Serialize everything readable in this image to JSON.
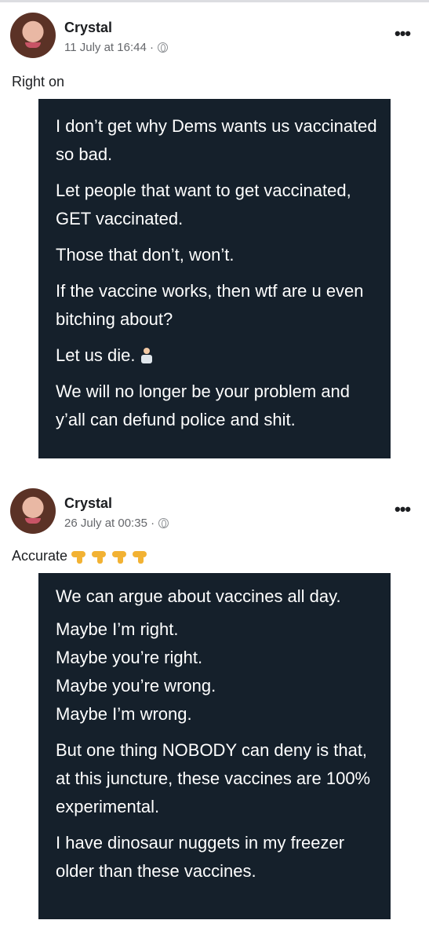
{
  "posts": [
    {
      "author": "Crystal",
      "meta": "11 July at 16:44 ·",
      "caption": "Right on",
      "tweet": [
        "I don’t get why Dems wants us vaccinated so bad.",
        "Let people that want to get vaccinated, GET vaccinated.",
        "Those that don’t, won’t.",
        "If the vaccine works, then wtf are u even bitching about?",
        "Let us die.",
        "We will no longer be your problem and y’all can defund police and shit."
      ],
      "icons": [
        "avatar-photo",
        "globe-icon",
        "more-options-icon",
        "person-shrugging-emoji"
      ]
    },
    {
      "author": "Crystal",
      "meta": "26 July at 00:35 ·",
      "caption": "Accurate",
      "tweet_lines": [
        "We can argue about vaccines all day.",
        "Maybe I’m right.",
        "Maybe you’re right.",
        "Maybe you’re wrong.",
        "Maybe I’m wrong."
      ],
      "tweet": [
        "But one thing NOBODY can deny is that, at this juncture, these vaccines are 100% experimental.",
        "I have dinosaur nuggets in my freezer older than these vaccines."
      ],
      "icons": [
        "avatar-photo",
        "globe-icon",
        "more-options-icon",
        "backhand-index-pointing-down-emoji"
      ]
    }
  ],
  "colors": {
    "tweet_background": "#15202b",
    "tweet_text": "#ffffff",
    "meta_text": "#65676b"
  }
}
